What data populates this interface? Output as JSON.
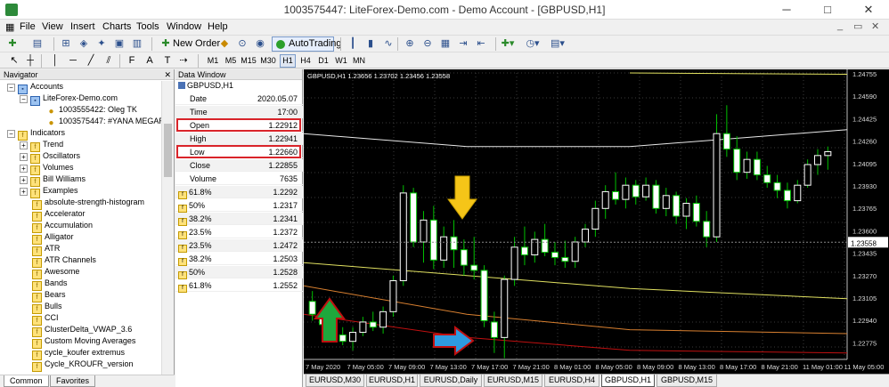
{
  "window": {
    "title": "1003575447: LiteForex-Demo.com - Demo Account - [GBPUSD,H1]"
  },
  "menu": [
    "File",
    "View",
    "Insert",
    "Charts",
    "Tools",
    "Window",
    "Help"
  ],
  "toolbar": {
    "new_order": "New Order",
    "autotrading": "AutoTrading"
  },
  "timeframes": [
    "M1",
    "M5",
    "M15",
    "M30",
    "H1",
    "H4",
    "D1",
    "W1",
    "MN"
  ],
  "active_timeframe": "H1",
  "navigator": {
    "title": "Navigator",
    "accounts_label": "Accounts",
    "server": "LiteForex-Demo.com",
    "users": [
      "1003555422: Oleg TK",
      "1003575447: #YANA MEGAR"
    ],
    "indicators_label": "Indicators",
    "groups": [
      "Trend",
      "Oscillators",
      "Volumes",
      "Bill Williams",
      "Examples"
    ],
    "items": [
      "absolute-strength-histogram",
      "Accelerator",
      "Accumulation",
      "Alligator",
      "ATR",
      "ATR Channels",
      "Awesome",
      "Bands",
      "Bears",
      "Bulls",
      "CCI",
      "ClusterDelta_VWAP_3.6",
      "Custom Moving Averages",
      "cycle_koufer extremus",
      "Cycle_KROUFR_version"
    ],
    "tabs": [
      "Common",
      "Favorites"
    ]
  },
  "data_window": {
    "title": "Data Window",
    "symbol": "GBPUSD,H1",
    "rows": [
      {
        "label": "Date",
        "value": "2020.05.07"
      },
      {
        "label": "Time",
        "value": "17:00"
      },
      {
        "label": "Open",
        "value": "1.22912"
      },
      {
        "label": "High",
        "value": "1.22941"
      },
      {
        "label": "Low",
        "value": "1.22660"
      },
      {
        "label": "Close",
        "value": "1.22855"
      },
      {
        "label": "Volume",
        "value": "7635"
      }
    ],
    "fibo": [
      {
        "label": "61.8%",
        "value": "1.2292"
      },
      {
        "label": "50%",
        "value": "1.2317"
      },
      {
        "label": "38.2%",
        "value": "1.2341"
      },
      {
        "label": "23.5%",
        "value": "1.2372"
      },
      {
        "label": "23.5%",
        "value": "1.2472"
      },
      {
        "label": "38.2%",
        "value": "1.2503"
      },
      {
        "label": "50%",
        "value": "1.2528"
      },
      {
        "label": "61.8%",
        "value": "1.2552"
      }
    ],
    "highlighted_rows": [
      "Open",
      "Low"
    ]
  },
  "chart": {
    "header": "GBPUSD,H1  1.23656 1.23702 1.23456 1.23558",
    "current_price": "1.23558",
    "price_ticks": [
      "1.24755",
      "1.24590",
      "1.24425",
      "1.24260",
      "1.24095",
      "1.23930",
      "1.23765",
      "1.23600",
      "1.23435",
      "1.23270",
      "1.23105",
      "1.22940",
      "1.22775"
    ],
    "time_ticks": [
      "7 May 2020",
      "7 May 05:00",
      "7 May 09:00",
      "7 May 13:00",
      "7 May 17:00",
      "7 May 21:00",
      "8 May 01:00",
      "8 May 05:00",
      "8 May 09:00",
      "8 May 13:00",
      "8 May 17:00",
      "8 May 21:00",
      "11 May 01:00",
      "11 May 05:00"
    ],
    "colors": {
      "background": "#000000",
      "bull": "#ffffff",
      "bear": "#ffffff",
      "wick": "#00c000",
      "ma_white": "#e8e8e8",
      "ma_yellow": "#e0e060",
      "ma_orange": "#d98030",
      "ma_red": "#c01010",
      "grid": "#3a3a3a"
    },
    "annotations": [
      "yellow-down-arrow",
      "green-up-arrow",
      "blue-right-arrow"
    ]
  },
  "chart_tabs": [
    "EURUSD,M30",
    "EURUSD,H1",
    "EURUSD,Daily",
    "EURUSD,M15",
    "EURUSD,H4",
    "GBPUSD,H1",
    "GBPUSD,M15"
  ],
  "active_chart_tab": "GBPUSD,H1",
  "chart_data": {
    "type": "candlestick",
    "ylim": [
      1.2265,
      1.2487
    ],
    "candles": [
      [
        1.231,
        1.2318,
        1.2295,
        1.23
      ],
      [
        1.23,
        1.2305,
        1.2288,
        1.2292
      ],
      [
        1.2292,
        1.2296,
        1.228,
        1.2284
      ],
      [
        1.2284,
        1.229,
        1.2276,
        1.2279
      ],
      [
        1.2279,
        1.229,
        1.2272,
        1.2286
      ],
      [
        1.2286,
        1.2298,
        1.2283,
        1.2294
      ],
      [
        1.2294,
        1.2302,
        1.2287,
        1.229
      ],
      [
        1.229,
        1.2306,
        1.2285,
        1.2302
      ],
      [
        1.2302,
        1.233,
        1.2298,
        1.2326
      ],
      [
        1.2326,
        1.24,
        1.2322,
        1.2394
      ],
      [
        1.2394,
        1.2398,
        1.2352,
        1.2356
      ],
      [
        1.2356,
        1.238,
        1.234,
        1.2373
      ],
      [
        1.2373,
        1.2384,
        1.2335,
        1.2342
      ],
      [
        1.2342,
        1.2368,
        1.2336,
        1.236
      ],
      [
        1.236,
        1.2373,
        1.2336,
        1.235
      ],
      [
        1.235,
        1.2358,
        1.233,
        1.2338
      ],
      [
        1.2338,
        1.236,
        1.2327,
        1.2334
      ],
      [
        1.2334,
        1.2338,
        1.229,
        1.2295
      ],
      [
        1.2294,
        1.2302,
        1.227,
        1.2282
      ],
      [
        1.2282,
        1.233,
        1.2266,
        1.2327
      ],
      [
        1.2327,
        1.236,
        1.2322,
        1.2352
      ],
      [
        1.2352,
        1.2368,
        1.2338,
        1.2346
      ],
      [
        1.2346,
        1.2364,
        1.234,
        1.2358
      ],
      [
        1.2358,
        1.237,
        1.2345,
        1.2348
      ],
      [
        1.2348,
        1.2356,
        1.2338,
        1.2344
      ],
      [
        1.2344,
        1.2357,
        1.2336,
        1.2341
      ],
      [
        1.2341,
        1.236,
        1.2336,
        1.2356
      ],
      [
        1.2356,
        1.237,
        1.2352,
        1.2366
      ],
      [
        1.2366,
        1.2388,
        1.236,
        1.2382
      ],
      [
        1.2382,
        1.24,
        1.2374,
        1.2395
      ],
      [
        1.2395,
        1.241,
        1.2385,
        1.2389
      ],
      [
        1.2389,
        1.2406,
        1.2382,
        1.24
      ],
      [
        1.24,
        1.2404,
        1.2385,
        1.2391
      ],
      [
        1.2391,
        1.2406,
        1.2388,
        1.24
      ],
      [
        1.24,
        1.2404,
        1.2378,
        1.2382
      ],
      [
        1.2382,
        1.2398,
        1.2376,
        1.2392
      ],
      [
        1.2392,
        1.2395,
        1.237,
        1.2376
      ],
      [
        1.2376,
        1.239,
        1.2366,
        1.2386
      ],
      [
        1.2386,
        1.2392,
        1.2368,
        1.2372
      ],
      [
        1.2372,
        1.238,
        1.2352,
        1.236
      ],
      [
        1.236,
        1.2455,
        1.2356,
        1.244
      ],
      [
        1.244,
        1.2462,
        1.2422,
        1.2428
      ],
      [
        1.2428,
        1.2438,
        1.2404,
        1.241
      ],
      [
        1.241,
        1.2426,
        1.2405,
        1.242
      ],
      [
        1.242,
        1.2426,
        1.2404,
        1.2408
      ],
      [
        1.2408,
        1.2415,
        1.2398,
        1.2402
      ],
      [
        1.2402,
        1.2408,
        1.239,
        1.2396
      ],
      [
        1.2396,
        1.2402,
        1.2382,
        1.2388
      ],
      [
        1.2388,
        1.2404,
        1.2386,
        1.24
      ],
      [
        1.24,
        1.242,
        1.2398,
        1.2416
      ],
      [
        1.2416,
        1.2428,
        1.2408,
        1.2423
      ],
      [
        1.2423,
        1.243,
        1.2412,
        1.2426
      ]
    ],
    "ma": {
      "white": [
        [
          0,
          1.244
        ],
        [
          0.3,
          1.243
        ],
        [
          0.6,
          1.243
        ],
        [
          1,
          1.2443
        ]
      ],
      "yellow": [
        [
          0,
          1.234
        ],
        [
          0.3,
          1.233
        ],
        [
          0.6,
          1.232
        ],
        [
          1,
          1.2312
        ]
      ],
      "orange": [
        [
          0,
          1.2322
        ],
        [
          0.3,
          1.23
        ],
        [
          0.6,
          1.2288
        ],
        [
          1,
          1.2285
        ]
      ],
      "red": [
        [
          0,
          1.23
        ],
        [
          0.3,
          1.2282
        ],
        [
          0.6,
          1.2272
        ],
        [
          1,
          1.227
        ]
      ],
      "top_yellow": [
        [
          0.6,
          1.2487
        ],
        [
          1,
          1.2486
        ]
      ]
    },
    "current_price": 1.23558
  }
}
